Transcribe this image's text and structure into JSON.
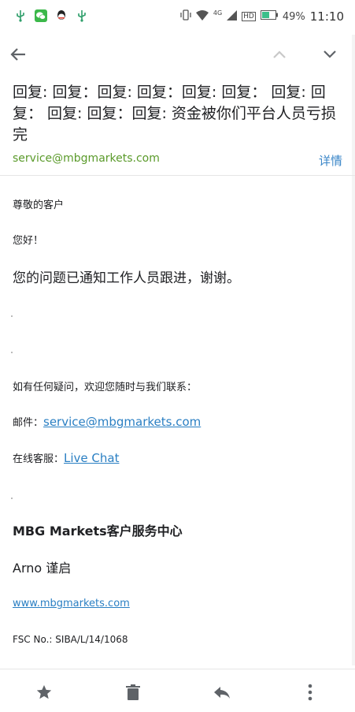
{
  "status_bar": {
    "network": "4G",
    "battery": "49%",
    "time": "11:10",
    "hd": "HD",
    "left_icons": [
      "usb-icon",
      "wechat-icon",
      "qq-icon",
      "usb-icon"
    ]
  },
  "toolbar": {
    "back_icon": "arrow-left-icon",
    "prev_icon": "chevron-up-icon",
    "next_icon": "chevron-down-icon"
  },
  "email": {
    "subject": "回复: 回复：回复: 回复：回复: 回复：  回复: 回复：  回复: 回复：回复: 资金被你们平台人员亏损完",
    "sender": "service@mbgmarkets.com",
    "details_label": "详情",
    "greeting_1": "尊敬的客户",
    "greeting_2": "您好！",
    "message": "您的问题已通知工作人员跟进，谢谢。",
    "contact_intro": "如有任何疑问，欢迎您随时与我们联系：",
    "email_label": "邮件：",
    "email_link": "service@mbgmarkets.com",
    "chat_label": "在线客服：",
    "chat_link": "Live Chat",
    "signature_company": "MBG Markets客户服务中心",
    "signature_name": "Arno 谨启",
    "website_link": "www.mbgmarkets.com",
    "fsc": "FSC No.: SIBA/L/14/1068"
  },
  "bottom_bar": {
    "star_icon": "star-icon",
    "delete_icon": "trash-icon",
    "reply_icon": "reply-icon",
    "more_icon": "more-vert-icon"
  },
  "colors": {
    "sender": "#5a9a2a",
    "link": "#2a7fc3",
    "icon": "#5f6368"
  }
}
